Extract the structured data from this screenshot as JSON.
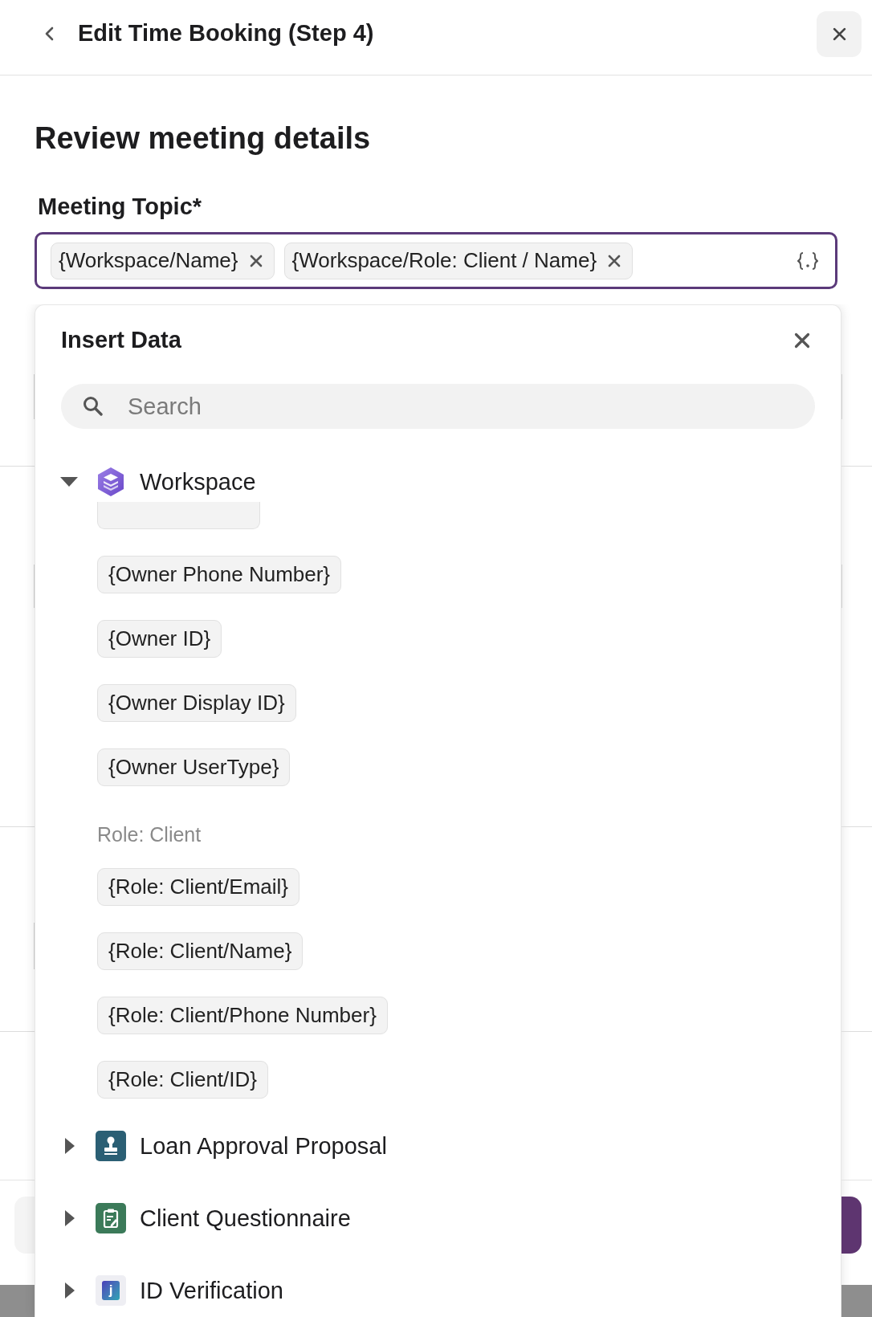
{
  "header": {
    "title": "Edit Time Booking (Step 4)"
  },
  "heading": "Review meeting details",
  "meeting_topic": {
    "label": "Meeting Topic*",
    "tokens": [
      {
        "label": "{Workspace/Name}"
      },
      {
        "label": "{Workspace/Role: Client / Name}"
      }
    ]
  },
  "insert_data": {
    "title": "Insert Data",
    "search": {
      "placeholder": "Search"
    },
    "sources": [
      {
        "name": "Workspace",
        "kind": "workspace",
        "expanded": true,
        "items": [
          {
            "kind": "clipped_chip"
          },
          {
            "kind": "chip",
            "label": "{Owner Phone Number}"
          },
          {
            "kind": "chip",
            "label": "{Owner ID}"
          },
          {
            "kind": "chip",
            "label": "{Owner Display ID}"
          },
          {
            "kind": "chip",
            "label": "{Owner UserType}"
          },
          {
            "kind": "heading",
            "label": "Role: Client"
          },
          {
            "kind": "chip",
            "label": "{Role: Client/Email}"
          },
          {
            "kind": "chip",
            "label": "{Role: Client/Name}"
          },
          {
            "kind": "chip",
            "label": "{Role: Client/Phone Number}"
          },
          {
            "kind": "chip",
            "label": "{Role: Client/ID}"
          }
        ]
      },
      {
        "name": "Loan Approval Proposal",
        "kind": "proposal",
        "expanded": false
      },
      {
        "name": "Client Questionnaire",
        "kind": "questionnaire",
        "expanded": false
      },
      {
        "name": "ID Verification",
        "kind": "verification",
        "expanded": false,
        "icon_letter": "j"
      }
    ]
  }
}
